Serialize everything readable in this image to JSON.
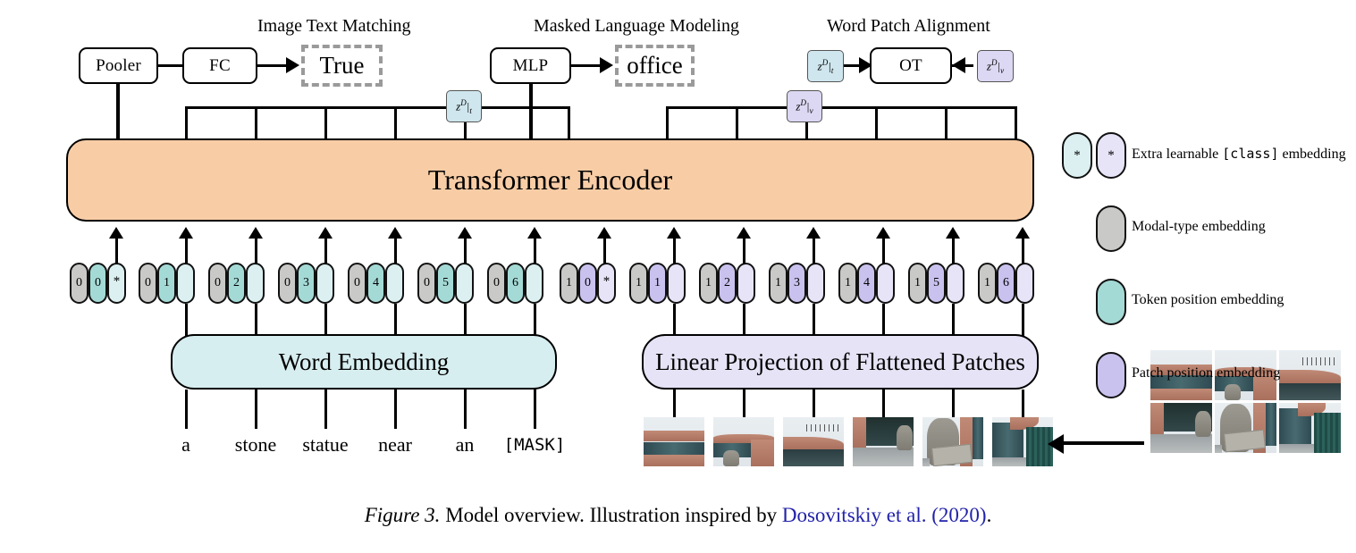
{
  "figure": {
    "caption_label": "Figure 3.",
    "caption_text": " Model overview. Illustration inspired by ",
    "caption_cite": "Dosovitskiy et al. (2020)",
    "caption_end": "."
  },
  "headings": {
    "itm": "Image Text Matching",
    "mlm": "Masked Language Modeling",
    "wpa": "Word Patch Alignment"
  },
  "heads": {
    "pooler": "Pooler",
    "fc": "FC",
    "itm_output": "True",
    "mlp": "MLP",
    "mlm_output": "office",
    "ot": "OT"
  },
  "z_tokens": {
    "z_text_wpa": "z^D|_t",
    "z_vis_wpa": "z^D|_v",
    "z_text_encoder": "z^D|_t",
    "z_vis_encoder": "z^D|_v",
    "base": "z",
    "sup": "D",
    "sub_text": "t",
    "sub_vis": "v"
  },
  "encoder": {
    "label": "Transformer Encoder"
  },
  "embedding_boxes": {
    "word": "Word Embedding",
    "patch": "Linear Projection of Flattened Patches"
  },
  "text_tokens": [
    {
      "modal": "0",
      "pos": "0",
      "emb": "*"
    },
    {
      "modal": "0",
      "pos": "1",
      "emb": ""
    },
    {
      "modal": "0",
      "pos": "2",
      "emb": ""
    },
    {
      "modal": "0",
      "pos": "3",
      "emb": ""
    },
    {
      "modal": "0",
      "pos": "4",
      "emb": ""
    },
    {
      "modal": "0",
      "pos": "5",
      "emb": ""
    },
    {
      "modal": "0",
      "pos": "6",
      "emb": ""
    }
  ],
  "image_tokens": [
    {
      "modal": "1",
      "pos": "0",
      "emb": "*"
    },
    {
      "modal": "1",
      "pos": "1",
      "emb": ""
    },
    {
      "modal": "1",
      "pos": "2",
      "emb": ""
    },
    {
      "modal": "1",
      "pos": "3",
      "emb": ""
    },
    {
      "modal": "1",
      "pos": "4",
      "emb": ""
    },
    {
      "modal": "1",
      "pos": "5",
      "emb": ""
    },
    {
      "modal": "1",
      "pos": "6",
      "emb": ""
    }
  ],
  "sentence": [
    "a",
    "stone",
    "statue",
    "near",
    "an",
    "[MASK]"
  ],
  "legend": [
    {
      "label_prefix": "Extra learnable ",
      "label_mono": "[class]",
      "label_suffix": " embedding",
      "glyph": "*",
      "colors": [
        "#dcf0f1",
        "#e7e4f7"
      ]
    },
    {
      "label": "Modal-type embedding",
      "color": "#c9c9c7"
    },
    {
      "label": "Token position embedding",
      "color": "#a4dad6"
    },
    {
      "label": "Patch position embedding",
      "color": "#c9c2ee"
    }
  ],
  "colors": {
    "encoder_fill": "#f8cda6",
    "word_embedding_fill": "#d7eef0",
    "patch_embedding_fill": "#e6e3f6",
    "modal_type": "#c9c9c7",
    "token_position": "#a4dad6",
    "word_embedding_pill": "#dcf0f1",
    "patch_position": "#c9c2ee",
    "patch_embedding_pill": "#e7e4f7",
    "z_text_box": "#cfe6ee",
    "z_vis_box": "#dcd7f2",
    "dashed_border": "#9a9a9a",
    "citation": "#2222aa"
  }
}
